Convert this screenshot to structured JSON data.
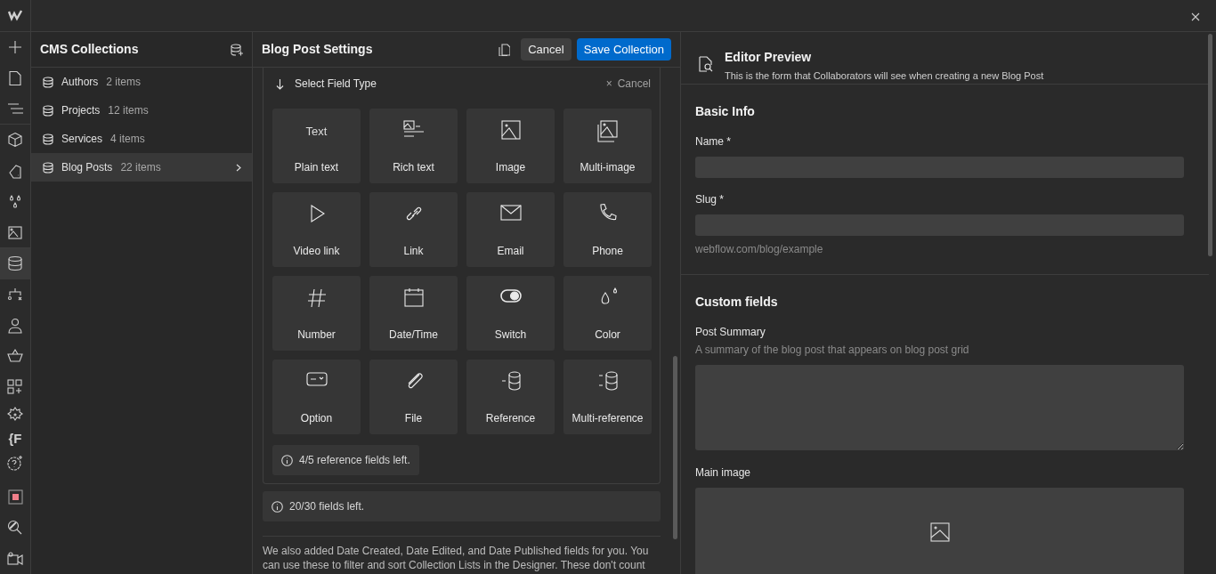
{
  "rail": [
    {
      "kind": "logo",
      "selected": false
    },
    {
      "kind": "plus",
      "selected": false
    },
    {
      "kind": "page",
      "selected": false
    },
    {
      "kind": "navigator",
      "selected": false
    },
    {
      "kind": "cube",
      "selected": false
    },
    {
      "kind": "style",
      "selected": false
    },
    {
      "kind": "drops",
      "selected": false
    },
    {
      "kind": "image",
      "selected": false
    },
    {
      "kind": "database",
      "selected": true
    },
    {
      "kind": "logic",
      "selected": false
    },
    {
      "kind": "user",
      "selected": false
    },
    {
      "kind": "basket",
      "selected": false
    },
    {
      "kind": "apps",
      "selected": false
    },
    {
      "kind": "gear",
      "selected": false
    },
    {
      "kind": "text",
      "label": "{F",
      "selected": false
    },
    {
      "kind": "help",
      "selected": false
    },
    {
      "kind": "record",
      "selected": false
    },
    {
      "kind": "search",
      "selected": false
    },
    {
      "kind": "video",
      "selected": false
    }
  ],
  "collections": {
    "title": "CMS Collections",
    "items": [
      {
        "name": "Authors",
        "count": "2 items",
        "selected": false
      },
      {
        "name": "Projects",
        "count": "12 items",
        "selected": false
      },
      {
        "name": "Services",
        "count": "4 items",
        "selected": false
      },
      {
        "name": "Blog Posts",
        "count": "22 items",
        "selected": true
      }
    ]
  },
  "settings": {
    "title": "Blog Post Settings",
    "cancel": "Cancel",
    "save": "Save Collection",
    "picker": {
      "title": "Select Field Type",
      "cancel": "Cancel",
      "close": "×",
      "types": [
        {
          "kind": "text",
          "glyph": "Text",
          "label": "Plain text"
        },
        {
          "kind": "richtext",
          "label": "Rich text"
        },
        {
          "kind": "image",
          "label": "Image"
        },
        {
          "kind": "multiimage",
          "label": "Multi-image"
        },
        {
          "kind": "video",
          "label": "Video link"
        },
        {
          "kind": "link",
          "label": "Link"
        },
        {
          "kind": "email",
          "label": "Email"
        },
        {
          "kind": "phone",
          "label": "Phone"
        },
        {
          "kind": "number",
          "label": "Number"
        },
        {
          "kind": "date",
          "label": "Date/Time"
        },
        {
          "kind": "switch",
          "label": "Switch"
        },
        {
          "kind": "color",
          "label": "Color"
        },
        {
          "kind": "option",
          "label": "Option"
        },
        {
          "kind": "file",
          "label": "File"
        },
        {
          "kind": "reference",
          "label": "Reference"
        },
        {
          "kind": "multireference",
          "label": "Multi-reference"
        }
      ],
      "note": "4/5 reference fields left."
    },
    "fields_left": "20/30 fields left.",
    "footnote": "We also added Date Created, Date Edited, and Date Published fields for you. You can use these to filter and sort Collection Lists in the Designer. These don't count"
  },
  "preview": {
    "title": "Editor Preview",
    "subtitle": "This is the form that Collaborators will see when creating a new Blog Post",
    "sections": [
      {
        "title": "Basic Info",
        "fields": [
          {
            "kind": "input",
            "label": "Name *"
          },
          {
            "kind": "input",
            "label": "Slug *",
            "help": "webflow.com/blog/example"
          }
        ]
      },
      {
        "title": "Custom fields",
        "fields": [
          {
            "kind": "textarea",
            "label": "Post Summary",
            "hint": "A summary of the blog post that appears on blog post grid"
          },
          {
            "kind": "image",
            "label": "Main image"
          }
        ]
      }
    ]
  }
}
